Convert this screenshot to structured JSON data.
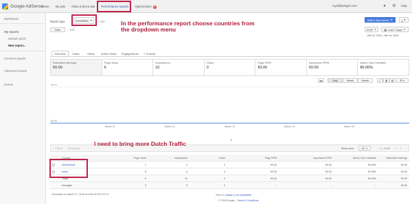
{
  "app": {
    "logo_text": "Google AdSense",
    "account": "myall@adsgrh.com",
    "help": "Help"
  },
  "topnav": {
    "items": [
      {
        "label": "Home"
      },
      {
        "label": "My ads"
      },
      {
        "label": "Allow & block ads"
      },
      {
        "label": "Performance reports"
      },
      {
        "label": "Optimization"
      }
    ],
    "optimization_badge": "4"
  },
  "sidebar": {
    "dashboard": "Dashboard",
    "my_reports": "My reports",
    "default_report": "Default report",
    "new_report": "New report...",
    "common_reports": "Common reports",
    "advanced_reports": "Advanced reports",
    "events": "Events"
  },
  "report": {
    "type_label": "Report type",
    "type_value": "Countries",
    "add_link": "+ add",
    "filter_label": "Filter",
    "filter_add": "+ add",
    "add_to_reports": "Add to My reports",
    "download_icon": "download-icon",
    "currency": "EUR",
    "date_range": "Last 7 days",
    "date_detail": "Mar 10, 2016 – Mar 16, 2016"
  },
  "tabs": [
    {
      "label": "Overview"
    },
    {
      "label": "Clicks"
    },
    {
      "label": "Views"
    },
    {
      "label": "Active Views"
    },
    {
      "label": "Engagements"
    },
    {
      "label": "+ Custom"
    }
  ],
  "metrics": [
    {
      "label": "Estimated earnings",
      "value": "€0.00"
    },
    {
      "label": "Page views",
      "value": "6"
    },
    {
      "label": "Impressions",
      "value": "10"
    },
    {
      "label": "Clicks",
      "value": "0"
    },
    {
      "label": "Page RPM",
      "value": "€0.00"
    },
    {
      "label": "Impression RPM",
      "value": "€0.00"
    },
    {
      "label": "Active View Viewable",
      "value": "80.00%"
    }
  ],
  "chart_controls": {
    "day": "Day",
    "week": "Week",
    "month": "Month"
  },
  "chart_data": {
    "type": "line",
    "y_ticks": [
      "€0.01",
      "€0.00"
    ],
    "x_ticks": [
      "March 11",
      "March 12",
      "March 13",
      "March 14",
      "March 15"
    ],
    "series": [
      {
        "values": [
          0,
          0,
          0,
          0,
          0,
          0,
          0
        ]
      }
    ]
  },
  "table_toolbar": {
    "pivot": "Pivot",
    "compare": "Compare",
    "show_rows_label": "Show rows:",
    "show_rows_value": "All",
    "pagination": "1 – 2 of 2"
  },
  "table": {
    "headers": [
      "Country",
      "Page views",
      "Impressions",
      "Clicks",
      "Page RPM",
      "Impression RPM",
      "Active View Viewable",
      "Estimated earnings"
    ],
    "rows": [
      [
        "Netherlands",
        "1",
        "2",
        "0",
        "€0.00",
        "€0.00",
        "50.00%",
        "€0.00"
      ],
      [
        "Israel",
        "5",
        "8",
        "0",
        "€0.00",
        "€0.00",
        "87.50%",
        "€0.00"
      ],
      [
        "Totals",
        "6",
        "10",
        "0",
        "€0.00",
        "€0.00",
        "80.00%",
        "€0.00"
      ],
      [
        "Averages",
        "3",
        "5",
        "0",
        "–",
        "–",
        "–",
        "€0.00"
      ]
    ],
    "generated": "Generated on March 17, 2016 at 4:05:16 PM UTC+2"
  },
  "footer": {
    "view_in": "View in:",
    "classic": "Classic",
    "low_bandwidth": "Low bandwidth",
    "copyright": "© 2016 Google",
    "terms": "Terms & Conditions"
  },
  "annotations": {
    "countries_note_line1": "In the performance report choose countries from",
    "countries_note_line2": "the dropdown menu",
    "dutch_note": "I need to bring more Dutch Traffic",
    "color": "#c0204a"
  }
}
